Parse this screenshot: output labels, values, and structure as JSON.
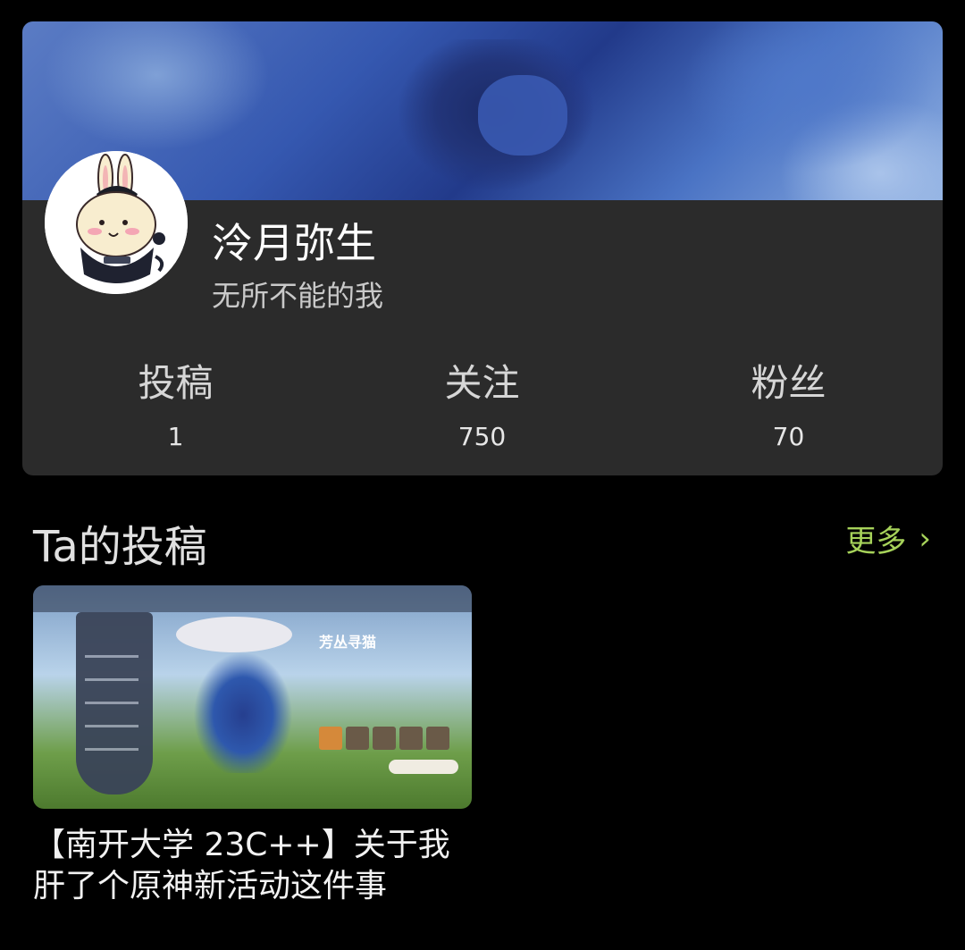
{
  "profile": {
    "name": "泠月弥生",
    "bio": "无所不能的我",
    "stats": [
      {
        "label": "投稿",
        "value": "1"
      },
      {
        "label": "关注",
        "value": "750"
      },
      {
        "label": "粉丝",
        "value": "70"
      }
    ]
  },
  "posts_section": {
    "title": "Ta的投稿",
    "more_label": "更多",
    "more_icon": "chevron-right-icon",
    "accent_color": "#a6d25a"
  },
  "posts": [
    {
      "title": "【南开大学 23C++】关于我肝了个原神新活动这件事",
      "thumbnail": {
        "event_title": "芳丛寻猫"
      }
    }
  ]
}
